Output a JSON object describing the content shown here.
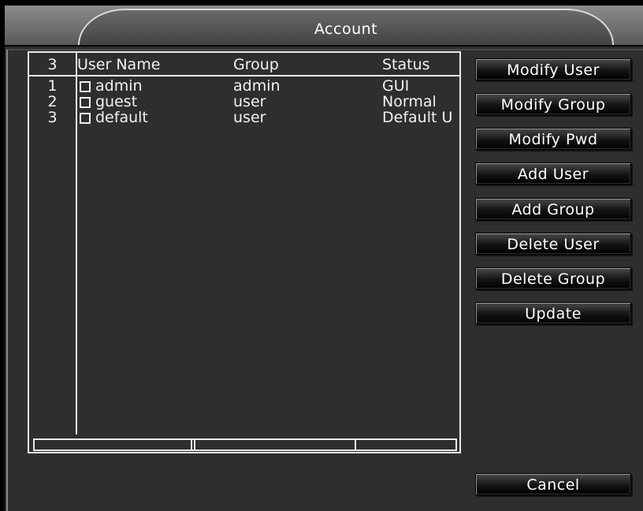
{
  "window": {
    "title": "Account"
  },
  "table": {
    "count_header": "3",
    "columns": [
      "User Name",
      "Group",
      "Status"
    ],
    "rows": [
      {
        "num": "1",
        "user": "admin",
        "group": "admin",
        "status": "GUI"
      },
      {
        "num": "2",
        "user": "guest",
        "group": "user",
        "status": "Normal"
      },
      {
        "num": "3",
        "user": "default",
        "group": "user",
        "status": "Default U"
      }
    ]
  },
  "buttons": {
    "modify_user": "Modify User",
    "modify_group": "Modify Group",
    "modify_pwd": "Modify Pwd",
    "add_user": "Add User",
    "add_group": "Add Group",
    "delete_user": "Delete User",
    "delete_group": "Delete Group",
    "update": "Update",
    "cancel": "Cancel"
  }
}
